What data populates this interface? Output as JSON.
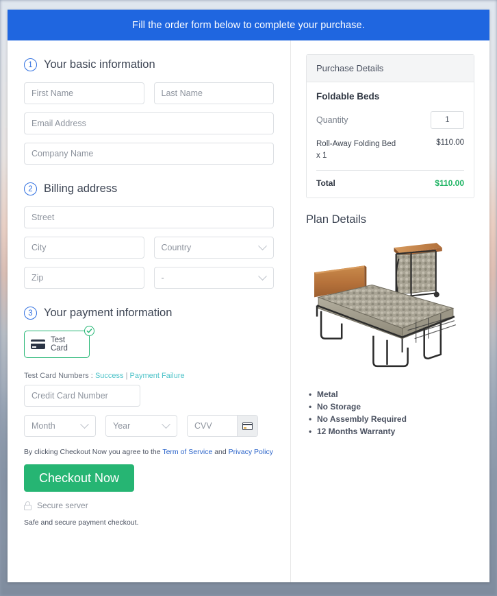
{
  "banner": {
    "text": "Fill the order form below to complete your purchase."
  },
  "steps": {
    "basic": {
      "number": "1",
      "title": "Your basic information"
    },
    "billing": {
      "number": "2",
      "title": "Billing address"
    },
    "payment": {
      "number": "3",
      "title": "Your payment information"
    }
  },
  "fields": {
    "first_name": "First Name",
    "last_name": "Last Name",
    "email": "Email Address",
    "company": "Company Name",
    "street": "Street",
    "city": "City",
    "country": "Country",
    "zip": "Zip",
    "state": "-",
    "credit_card": "Credit Card Number",
    "month": "Month",
    "year": "Year",
    "cvv": "CVV"
  },
  "payment": {
    "tile_label": "Test Card",
    "tile_selected": true,
    "test_cards_label": "Test Card Numbers :",
    "success_link": "Success",
    "separator": "|",
    "failure_link": "Payment Failure"
  },
  "terms": {
    "prefix": "By clicking Checkout Now you agree to the",
    "tos_link": "Term of Service",
    "middle": "and",
    "privacy_link": "Privacy Policy"
  },
  "actions": {
    "checkout_label": "Checkout Now",
    "secure_server": "Secure server",
    "footnote": "Safe and secure payment checkout."
  },
  "purchase": {
    "header": "Purchase Details",
    "product_name": "Foldable Beds",
    "quantity_label": "Quantity",
    "quantity_value": "1",
    "line_item_desc": "Roll-Away Folding Bed x 1",
    "line_item_amount": "$110.00",
    "total_label": "Total",
    "total_amount": "$110.00"
  },
  "plan": {
    "title": "Plan Details",
    "image_alt": "folding-bed-image",
    "features": [
      "Metal",
      "No Storage",
      "No Assembly Required",
      "12 Months Warranty"
    ]
  },
  "colors": {
    "banner_blue": "#1f66e0",
    "accent_green": "#26b573",
    "total_green": "#1fb464",
    "link_blue": "#2a63c9",
    "link_teal": "#4ec3c9",
    "step_blue": "#2f6fe0"
  }
}
